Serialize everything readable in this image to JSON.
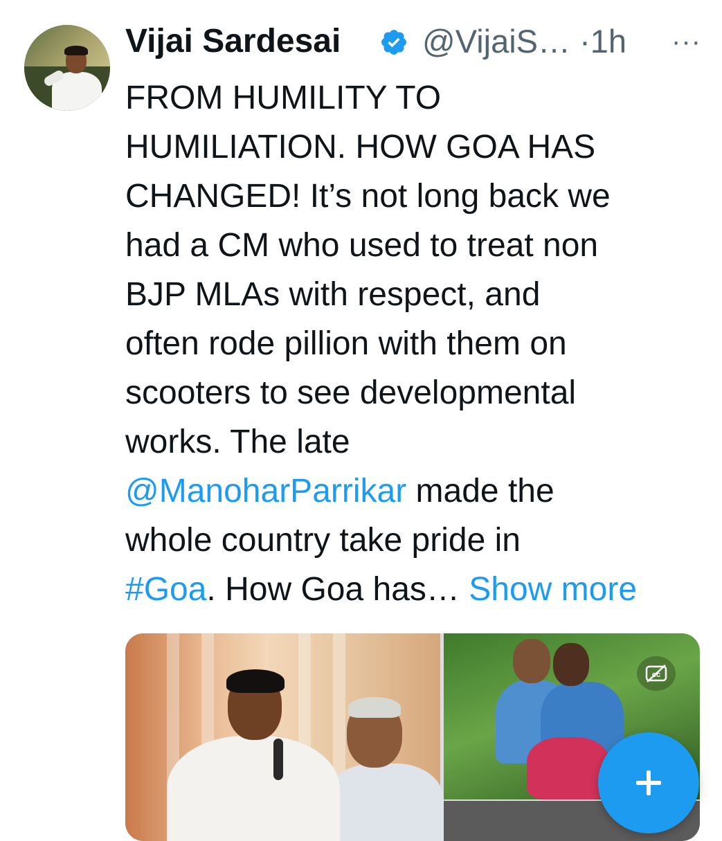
{
  "tweet": {
    "author_name": "Vijai Sardesai",
    "author_handle": "@VijaiS…",
    "separator": "·",
    "time_ago": "1h",
    "more_label": "···",
    "body_lines": [
      "FROM HUMILITY TO",
      "HUMILIATION. HOW GOA HAS",
      "CHANGED! It’s not long back we",
      "had a CM who used to treat non",
      "BJP MLAs with respect, and",
      "often rode pillion with them on",
      "scooters to see developmental",
      "works. The late"
    ],
    "mention": "@ManoharParrikar",
    "after_mention": " made the",
    "line10": "whole country take pride in",
    "hashtag": "#Goa",
    "after_hashtag": ". How Goa has… ",
    "show_more": "Show more"
  },
  "icons": {
    "avatar": "profile-photo",
    "verified": "verified-badge-icon",
    "captions": "closed-captions-off-icon",
    "compose": "plus-icon"
  },
  "colors": {
    "link": "#1d9bf0",
    "text": "#0f1419",
    "muted": "#536471"
  }
}
